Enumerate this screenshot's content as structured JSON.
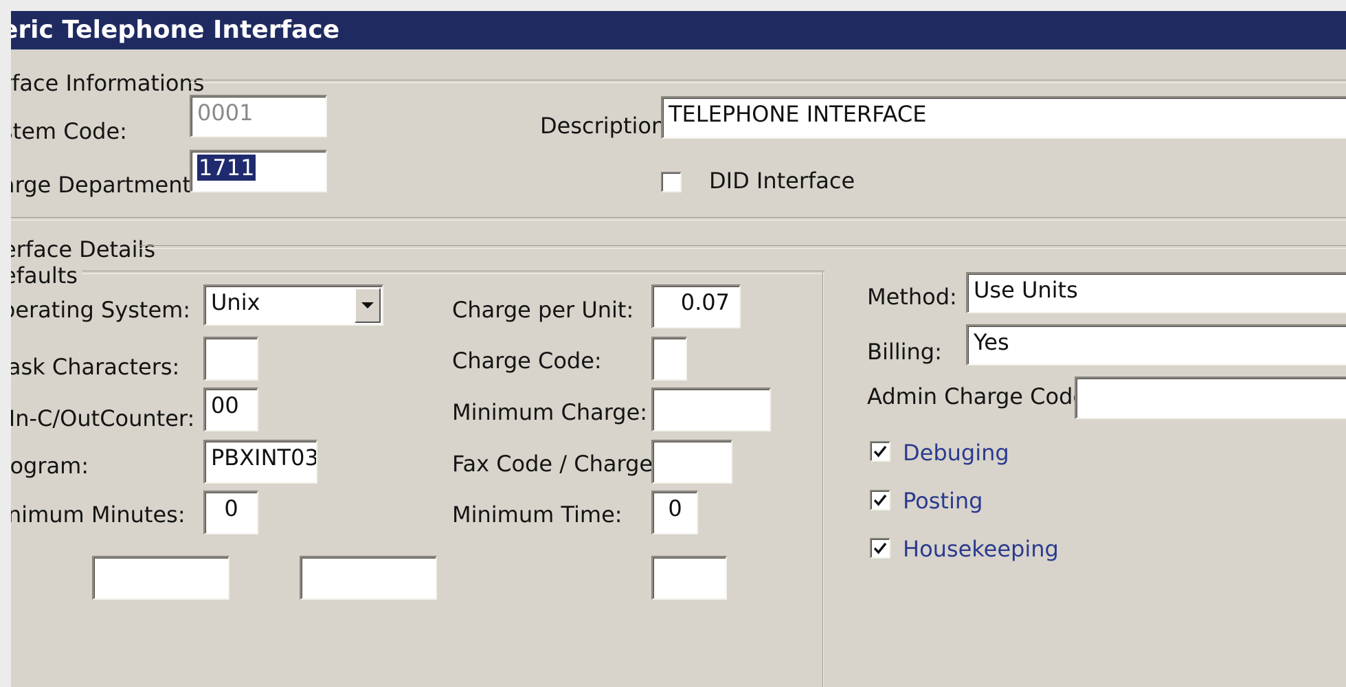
{
  "window": {
    "title": "eric Telephone Interface"
  },
  "interface_info": {
    "section_label": "rface Informations",
    "system_code_label": "stem Code:",
    "system_code_value": "0001",
    "charge_department_label": "arge Department:",
    "charge_department_value": "1711",
    "description_label": "Description:",
    "description_value": "TELEPHONE INTERFACE",
    "did_interface_label": "DID Interface",
    "did_interface_checked": false
  },
  "interface_details": {
    "section_label": "erface Details",
    "defaults_label": "efaults",
    "operating_system_label": "perating System:",
    "operating_system_value": "Unix",
    "mask_characters_label": "lask Characters:",
    "mask_characters_value": "",
    "counter_label": "/In-C/OutCounter:",
    "counter_value": "00",
    "program_label": "rogram:",
    "program_value": "PBXINT03",
    "minimum_minutes_label": "inimum Minutes:",
    "minimum_minutes_value": "0",
    "charge_per_unit_label": "Charge per Unit:",
    "charge_per_unit_value": "0.07",
    "charge_code_label": "Charge Code:",
    "charge_code_value": "",
    "minimum_charge_label": "Minimum Charge:",
    "minimum_charge_value": "",
    "fax_code_label": "Fax Code / Charge:",
    "fax_code_value": "",
    "minimum_time_label": "Minimum Time:",
    "minimum_time_value": "0"
  },
  "options": {
    "method_label": "Method:",
    "method_value": "Use Units",
    "billing_label": "Billing:",
    "billing_value": "Yes",
    "admin_charge_code_label": "Admin Charge Code:",
    "debuging_label": "Debuging",
    "debuging_checked": true,
    "posting_label": "Posting",
    "posting_checked": true,
    "housekeeping_label": "Housekeeping",
    "housekeeping_checked": true
  },
  "icons": {
    "dropdown": "chevron-down-icon",
    "checkmark": "checkmark-icon"
  },
  "colors": {
    "title_bar": "#1f2b60",
    "window_bg": "#d8d4cb",
    "selection": "#1f2b6e",
    "link_blue": "#2b3a8f"
  }
}
